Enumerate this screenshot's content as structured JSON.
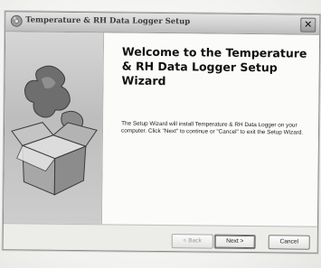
{
  "window": {
    "title": "Temperature & RH Data Logger Setup",
    "close_glyph": "✕"
  },
  "icons": {
    "title_icon": "setup-disc-icon",
    "side_art": "puzzle-box-icon",
    "close": "close-icon"
  },
  "main": {
    "heading": "Welcome to the Temperature & RH Data Logger Setup Wizard",
    "description": "The Setup Wizard will install Temperature & RH Data Logger on your computer.  Click \"Next\" to continue or \"Cancel\" to exit the Setup Wizard."
  },
  "buttons": {
    "back": "< Back",
    "next": "Next >",
    "cancel": "Cancel"
  }
}
